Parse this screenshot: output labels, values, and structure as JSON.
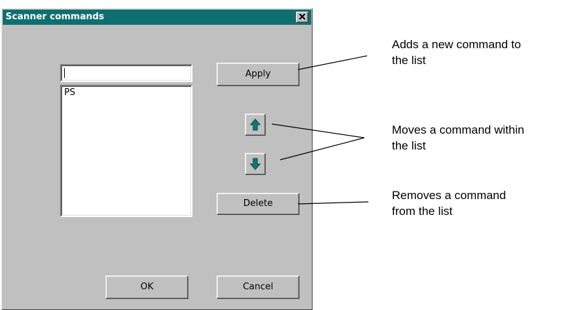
{
  "dialog": {
    "title": "Scanner commands",
    "close_glyph": "×",
    "command_input": {
      "value": ""
    },
    "commands": [
      {
        "label": "PS"
      }
    ],
    "buttons": {
      "apply": "Apply",
      "move_up_icon": "up-arrow-icon",
      "move_down_icon": "down-arrow-icon",
      "delete": "Delete",
      "ok": "OK",
      "cancel": "Cancel"
    },
    "colors": {
      "titlebar": "#0f6e6e",
      "face": "#c0c0c0",
      "arrow": "#0f7a6e"
    }
  },
  "annotations": {
    "apply": {
      "line1": "Adds a new command to",
      "line2": "the list"
    },
    "move": {
      "line1": "Moves a command within",
      "line2": "the list"
    },
    "delete": {
      "line1": "Removes a command",
      "line2": "from the list"
    }
  }
}
